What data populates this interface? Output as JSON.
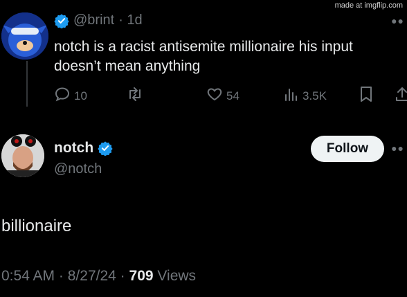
{
  "watermark": "made at imgflip.com",
  "reply": {
    "handle": "@brint",
    "time": "· 1d",
    "text": "notch is a racist antisemite millionaire his input doesn’t mean anything",
    "stats": {
      "replies": "10",
      "likes": "54",
      "views": "3.5K"
    }
  },
  "tweet": {
    "author_name": "notch",
    "author_handle": "@notch",
    "follow_label": "Follow",
    "text": "billionaire",
    "time": "0:54 AM",
    "date": "8/27/24",
    "views_count": "709",
    "views_label": "Views"
  },
  "colors": {
    "verified": "#1d9bf0",
    "muted": "#71767b",
    "text": "#e7e9ea",
    "background": "#000000"
  },
  "icons": [
    "reply-icon",
    "retweet-icon",
    "like-icon",
    "views-icon",
    "bookmark-icon",
    "share-icon",
    "verified-badge-icon",
    "more-icon"
  ]
}
